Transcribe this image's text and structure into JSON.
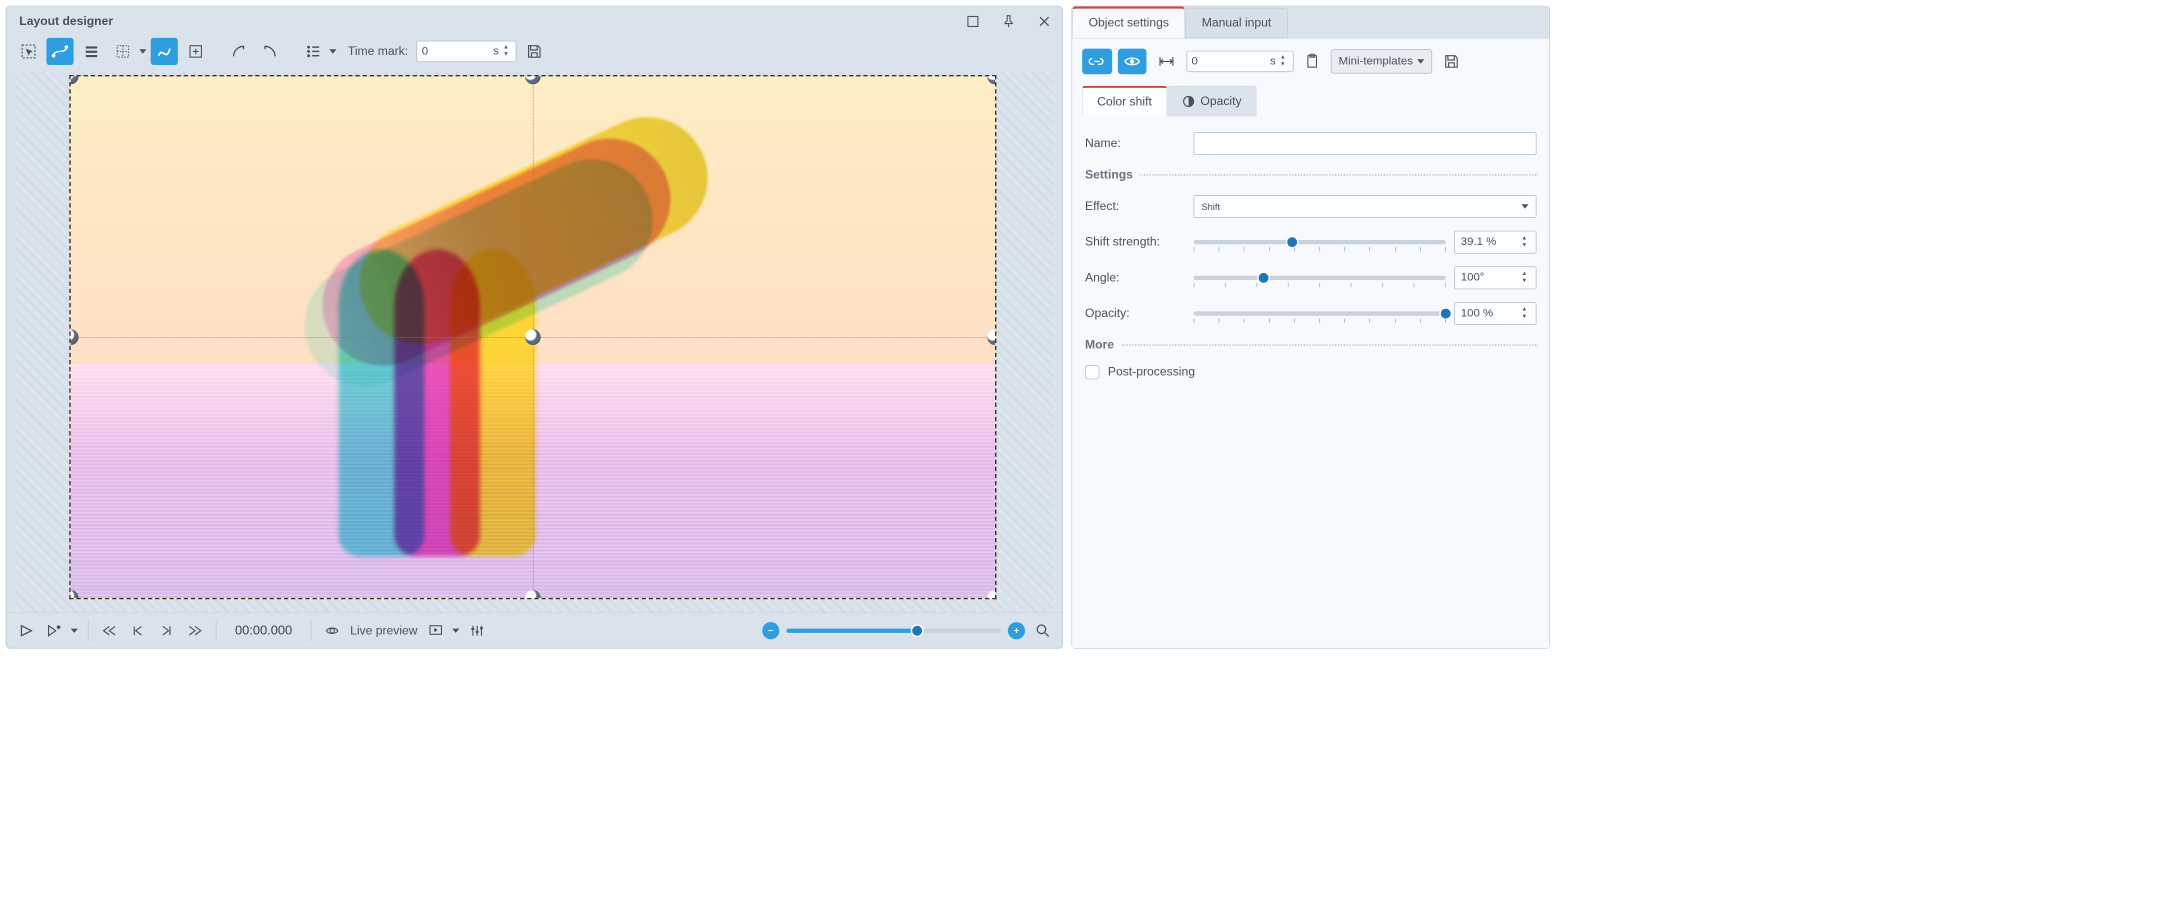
{
  "left": {
    "title": "Layout designer",
    "time_mark_label": "Time mark:",
    "time_mark_value": "0",
    "time_mark_unit": "s",
    "timecode": "00:00.000",
    "live_preview_label": "Live preview"
  },
  "right": {
    "tabs": {
      "obj": "Object settings",
      "manual": "Manual input"
    },
    "toolbar": {
      "time_value": "0",
      "time_unit": "s",
      "mini_templates": "Mini-templates"
    },
    "sub_tabs": {
      "color_shift": "Color shift",
      "opacity": "Opacity"
    },
    "fields": {
      "name_label": "Name:",
      "name_value": "",
      "settings_head": "Settings",
      "effect_label": "Effect:",
      "effect_value": "Shift",
      "shift_label": "Shift strength:",
      "shift_value": "39.1 %",
      "angle_label": "Angle:",
      "angle_value": "100°",
      "opacity_label": "Opacity:",
      "opacity_value": "100 %",
      "more_head": "More",
      "post_proc": "Post-processing"
    }
  },
  "sliders": {
    "shift_pct": 39.1,
    "angle_pct": 27.8,
    "opacity_pct": 100,
    "zoom_pct": 61
  }
}
